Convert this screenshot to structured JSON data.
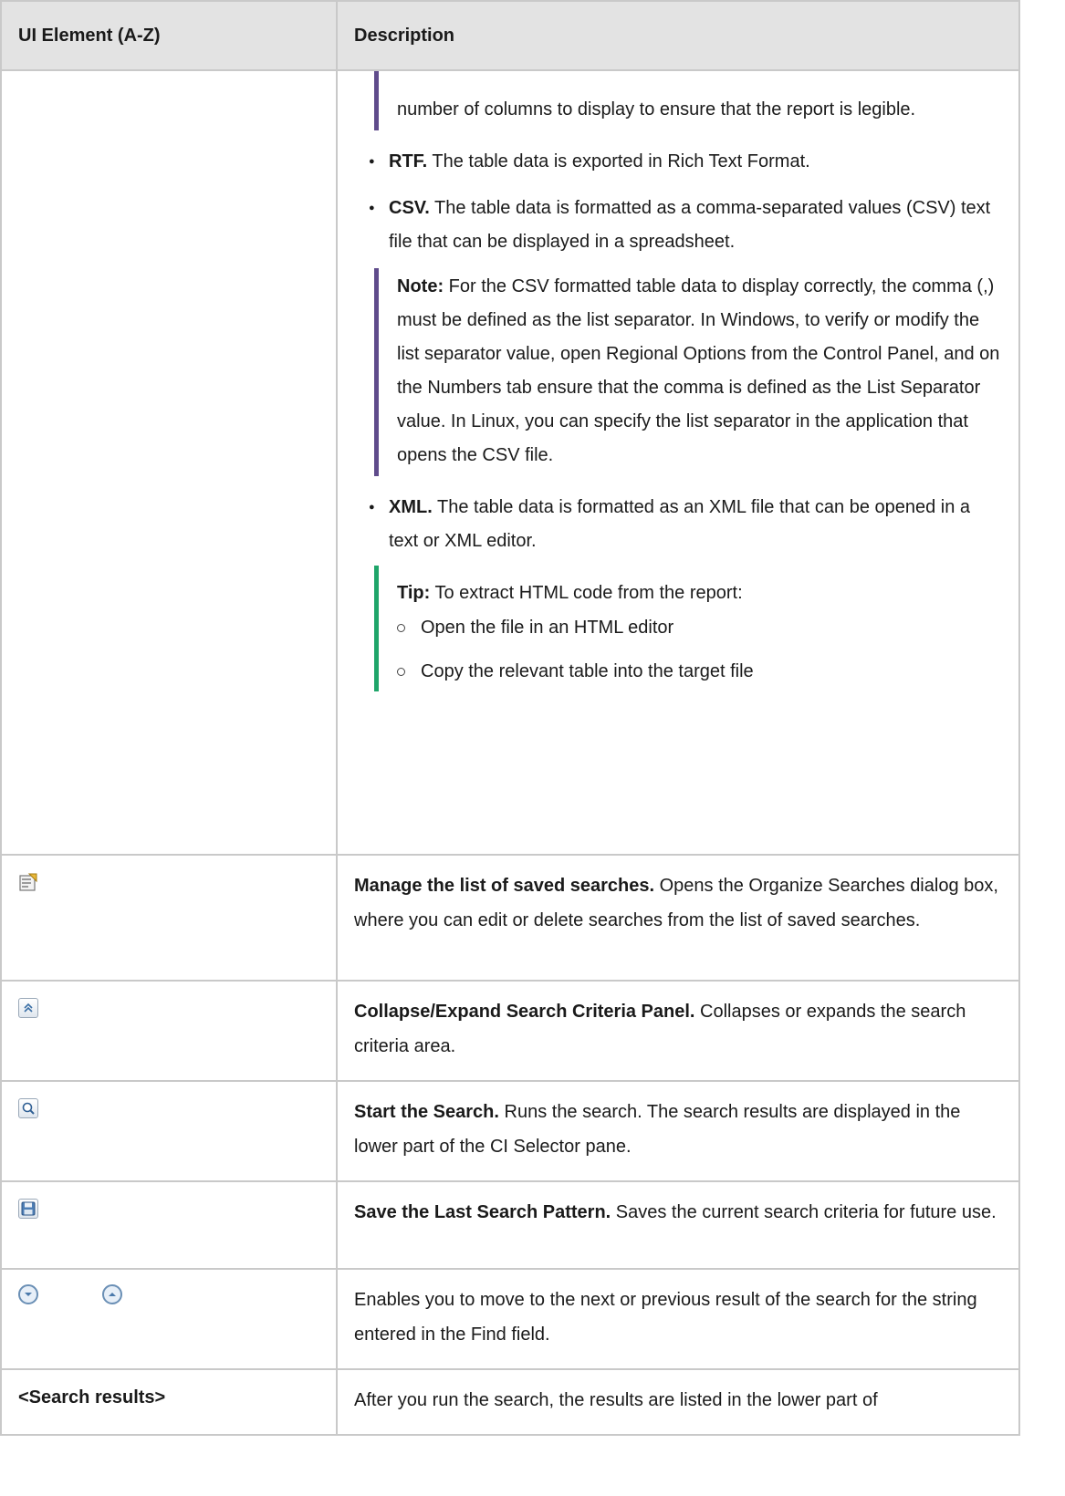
{
  "table": {
    "header": {
      "col1": "UI Element (A-Z)",
      "col2": "Description"
    },
    "cont_row": {
      "note_top": "number of columns to display to ensure that the report is legible.",
      "bullets": [
        {
          "term": "RTF.",
          "text": " The table data is exported in Rich Text Format."
        },
        {
          "term": "CSV.",
          "text": " The table data is formatted as a comma-separated values (CSV) text file that can be displayed in a spreadsheet."
        },
        {
          "term": "XML.",
          "text": " The table data is formatted as an XML file that can be opened in a text or XML editor."
        }
      ],
      "csv_note": {
        "label": "Note:",
        "text": "  For the CSV formatted table data to display correctly, the comma (,) must be defined as the list separator. In Windows, to verify or modify the list separator value, open Regional Options from the Control Panel, and on the Numbers tab ensure that the comma is defined as the List Separator value. In Linux, you can specify the list separator in the application that opens the CSV file."
      },
      "tip": {
        "label": "Tip:",
        "text": "  To extract HTML code from the report:",
        "items": [
          "Open the file in an HTML editor",
          "Copy the relevant table into the target file"
        ]
      }
    },
    "rows": [
      {
        "icon": "manage-searches-icon",
        "title": "Manage the list of saved searches.",
        "text": " Opens the Organize Searches dialog box, where you can edit or delete searches from the list of saved searches."
      },
      {
        "icon": "collapse-expand-icon",
        "title": "Collapse/Expand Search Criteria Panel.",
        "text": " Collapses or expands the search criteria area."
      },
      {
        "icon": "search-icon",
        "title": "Start the Search.",
        "text": " Runs the search. The search results are displayed in the lower part of the CI Selector pane."
      },
      {
        "icon": "save-icon",
        "title": "Save the Last Search Pattern.",
        "text": " Saves the current search criteria for future use."
      },
      {
        "icon": "next-previous-icons",
        "title": "",
        "text": "Enables you to move to the next or previous result of the search for the string entered in the Find field."
      }
    ],
    "last_row": {
      "label": "<Search results>",
      "text": "After you run the search, the results are listed in the lower part of"
    }
  }
}
